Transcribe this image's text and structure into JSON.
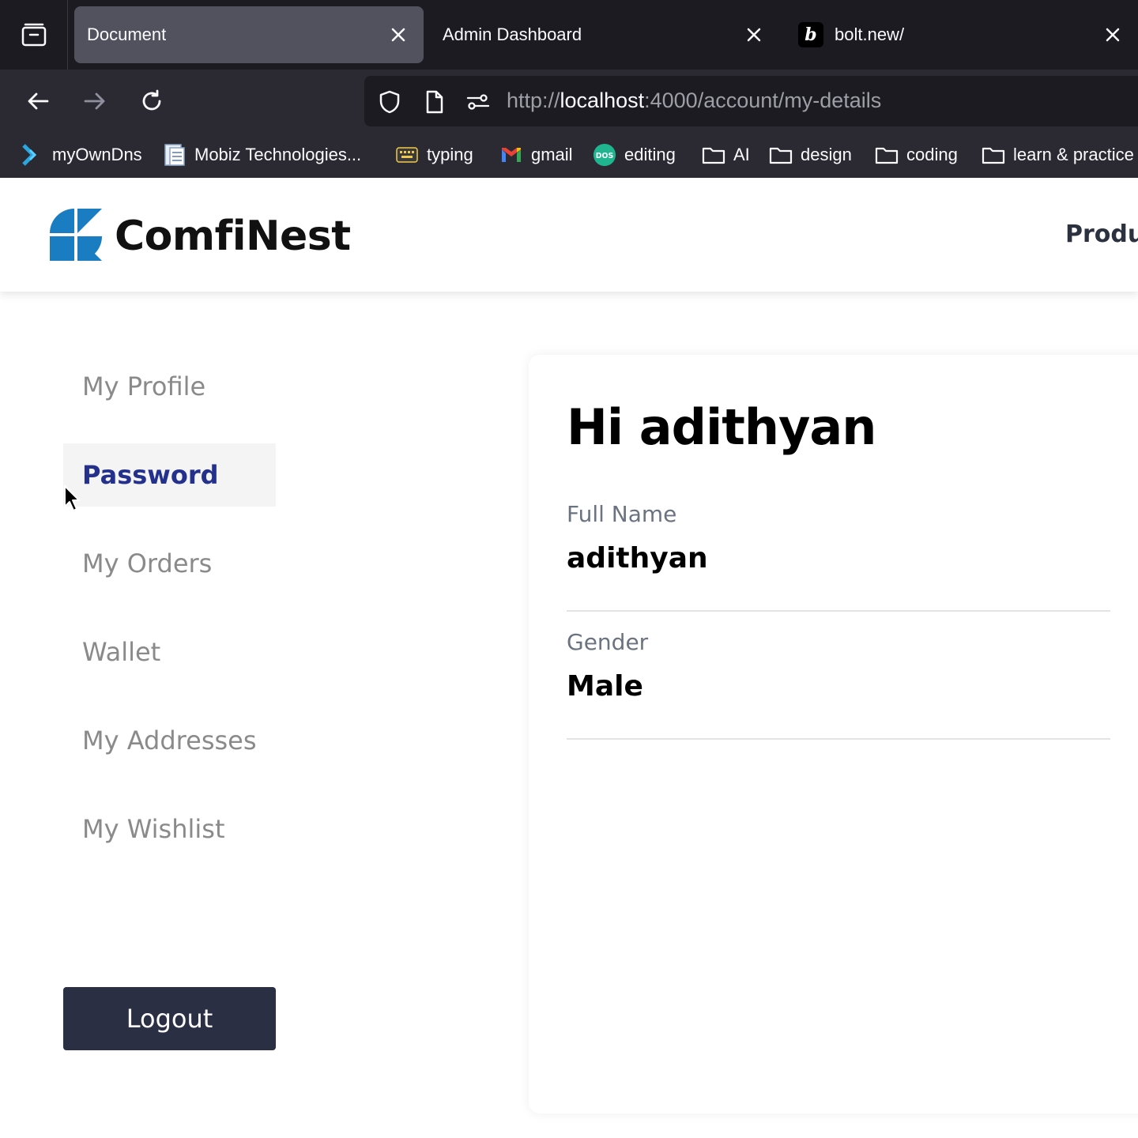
{
  "browser": {
    "tabs": [
      {
        "title": "Document",
        "active": true
      },
      {
        "title": "Admin Dashboard",
        "active": false
      },
      {
        "title": "bolt.new/",
        "active": false
      }
    ],
    "url": {
      "scheme": "http://",
      "host": "localhost",
      "rest": ":4000/account/my-details"
    },
    "bookmarks": [
      {
        "label": "myOwnDns",
        "icon": "arrow-logo-icon"
      },
      {
        "label": "Mobiz Technologies...",
        "icon": "document-icon"
      },
      {
        "label": "typing",
        "icon": "keyboard-icon"
      },
      {
        "label": "gmail",
        "icon": "gmail-icon"
      },
      {
        "label": "editing",
        "icon": "dos-icon"
      },
      {
        "label": "AI",
        "icon": "folder-icon"
      },
      {
        "label": "design",
        "icon": "folder-icon"
      },
      {
        "label": "coding",
        "icon": "folder-icon"
      },
      {
        "label": "learn & practice",
        "icon": "folder-icon"
      }
    ]
  },
  "site": {
    "brand": "ComfiNest",
    "nav_partial": "Produ",
    "brand_color": "#1a7cc1"
  },
  "sidebar": {
    "items": [
      {
        "label": "My Profile",
        "active": false
      },
      {
        "label": "Password",
        "active": true
      },
      {
        "label": "My Orders",
        "active": false
      },
      {
        "label": "Wallet",
        "active": false
      },
      {
        "label": "My Addresses",
        "active": false
      },
      {
        "label": "My Wishlist",
        "active": false
      }
    ],
    "logout_label": "Logout"
  },
  "profile": {
    "greeting": "Hi adithyan",
    "fields": [
      {
        "label": "Full Name",
        "value": "adithyan"
      },
      {
        "label": "Gender",
        "value": "Male"
      }
    ]
  }
}
